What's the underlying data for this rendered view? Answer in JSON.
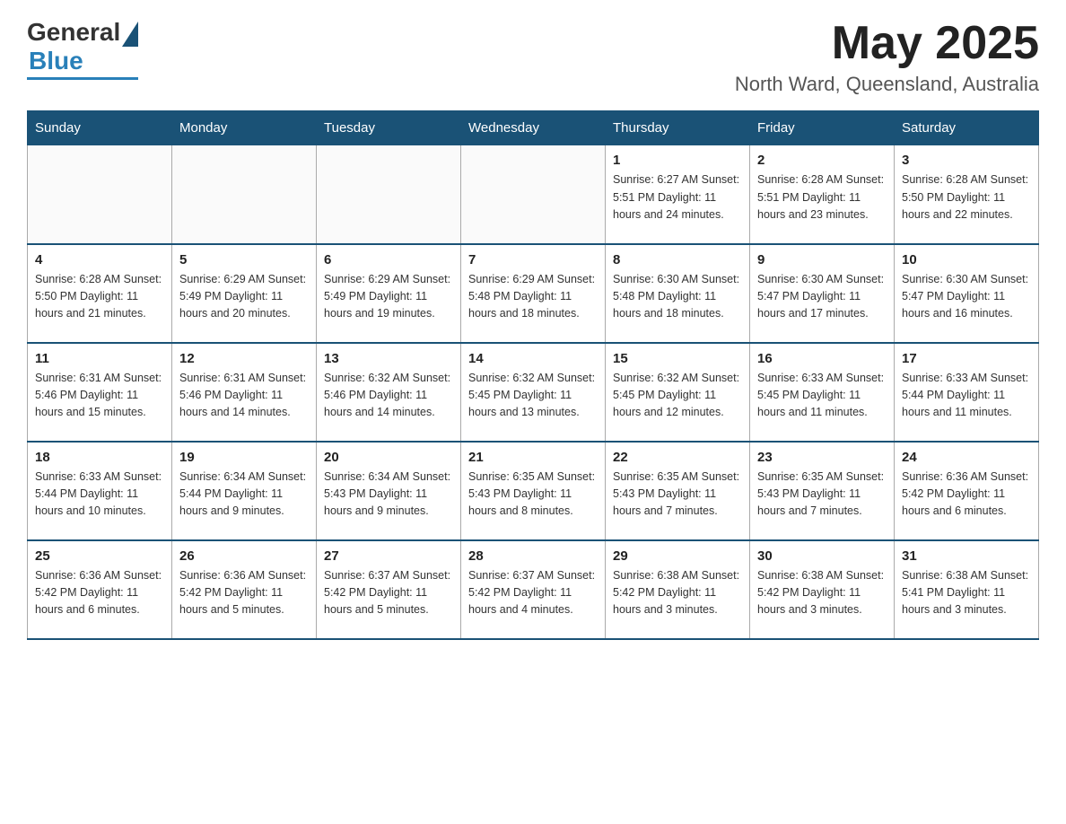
{
  "logo": {
    "general": "General",
    "blue": "Blue"
  },
  "header": {
    "month": "May 2025",
    "location": "North Ward, Queensland, Australia"
  },
  "days_of_week": [
    "Sunday",
    "Monday",
    "Tuesday",
    "Wednesday",
    "Thursday",
    "Friday",
    "Saturday"
  ],
  "weeks": [
    [
      {
        "day": "",
        "info": ""
      },
      {
        "day": "",
        "info": ""
      },
      {
        "day": "",
        "info": ""
      },
      {
        "day": "",
        "info": ""
      },
      {
        "day": "1",
        "info": "Sunrise: 6:27 AM\nSunset: 5:51 PM\nDaylight: 11 hours and 24 minutes."
      },
      {
        "day": "2",
        "info": "Sunrise: 6:28 AM\nSunset: 5:51 PM\nDaylight: 11 hours and 23 minutes."
      },
      {
        "day": "3",
        "info": "Sunrise: 6:28 AM\nSunset: 5:50 PM\nDaylight: 11 hours and 22 minutes."
      }
    ],
    [
      {
        "day": "4",
        "info": "Sunrise: 6:28 AM\nSunset: 5:50 PM\nDaylight: 11 hours and 21 minutes."
      },
      {
        "day": "5",
        "info": "Sunrise: 6:29 AM\nSunset: 5:49 PM\nDaylight: 11 hours and 20 minutes."
      },
      {
        "day": "6",
        "info": "Sunrise: 6:29 AM\nSunset: 5:49 PM\nDaylight: 11 hours and 19 minutes."
      },
      {
        "day": "7",
        "info": "Sunrise: 6:29 AM\nSunset: 5:48 PM\nDaylight: 11 hours and 18 minutes."
      },
      {
        "day": "8",
        "info": "Sunrise: 6:30 AM\nSunset: 5:48 PM\nDaylight: 11 hours and 18 minutes."
      },
      {
        "day": "9",
        "info": "Sunrise: 6:30 AM\nSunset: 5:47 PM\nDaylight: 11 hours and 17 minutes."
      },
      {
        "day": "10",
        "info": "Sunrise: 6:30 AM\nSunset: 5:47 PM\nDaylight: 11 hours and 16 minutes."
      }
    ],
    [
      {
        "day": "11",
        "info": "Sunrise: 6:31 AM\nSunset: 5:46 PM\nDaylight: 11 hours and 15 minutes."
      },
      {
        "day": "12",
        "info": "Sunrise: 6:31 AM\nSunset: 5:46 PM\nDaylight: 11 hours and 14 minutes."
      },
      {
        "day": "13",
        "info": "Sunrise: 6:32 AM\nSunset: 5:46 PM\nDaylight: 11 hours and 14 minutes."
      },
      {
        "day": "14",
        "info": "Sunrise: 6:32 AM\nSunset: 5:45 PM\nDaylight: 11 hours and 13 minutes."
      },
      {
        "day": "15",
        "info": "Sunrise: 6:32 AM\nSunset: 5:45 PM\nDaylight: 11 hours and 12 minutes."
      },
      {
        "day": "16",
        "info": "Sunrise: 6:33 AM\nSunset: 5:45 PM\nDaylight: 11 hours and 11 minutes."
      },
      {
        "day": "17",
        "info": "Sunrise: 6:33 AM\nSunset: 5:44 PM\nDaylight: 11 hours and 11 minutes."
      }
    ],
    [
      {
        "day": "18",
        "info": "Sunrise: 6:33 AM\nSunset: 5:44 PM\nDaylight: 11 hours and 10 minutes."
      },
      {
        "day": "19",
        "info": "Sunrise: 6:34 AM\nSunset: 5:44 PM\nDaylight: 11 hours and 9 minutes."
      },
      {
        "day": "20",
        "info": "Sunrise: 6:34 AM\nSunset: 5:43 PM\nDaylight: 11 hours and 9 minutes."
      },
      {
        "day": "21",
        "info": "Sunrise: 6:35 AM\nSunset: 5:43 PM\nDaylight: 11 hours and 8 minutes."
      },
      {
        "day": "22",
        "info": "Sunrise: 6:35 AM\nSunset: 5:43 PM\nDaylight: 11 hours and 7 minutes."
      },
      {
        "day": "23",
        "info": "Sunrise: 6:35 AM\nSunset: 5:43 PM\nDaylight: 11 hours and 7 minutes."
      },
      {
        "day": "24",
        "info": "Sunrise: 6:36 AM\nSunset: 5:42 PM\nDaylight: 11 hours and 6 minutes."
      }
    ],
    [
      {
        "day": "25",
        "info": "Sunrise: 6:36 AM\nSunset: 5:42 PM\nDaylight: 11 hours and 6 minutes."
      },
      {
        "day": "26",
        "info": "Sunrise: 6:36 AM\nSunset: 5:42 PM\nDaylight: 11 hours and 5 minutes."
      },
      {
        "day": "27",
        "info": "Sunrise: 6:37 AM\nSunset: 5:42 PM\nDaylight: 11 hours and 5 minutes."
      },
      {
        "day": "28",
        "info": "Sunrise: 6:37 AM\nSunset: 5:42 PM\nDaylight: 11 hours and 4 minutes."
      },
      {
        "day": "29",
        "info": "Sunrise: 6:38 AM\nSunset: 5:42 PM\nDaylight: 11 hours and 3 minutes."
      },
      {
        "day": "30",
        "info": "Sunrise: 6:38 AM\nSunset: 5:42 PM\nDaylight: 11 hours and 3 minutes."
      },
      {
        "day": "31",
        "info": "Sunrise: 6:38 AM\nSunset: 5:41 PM\nDaylight: 11 hours and 3 minutes."
      }
    ]
  ]
}
